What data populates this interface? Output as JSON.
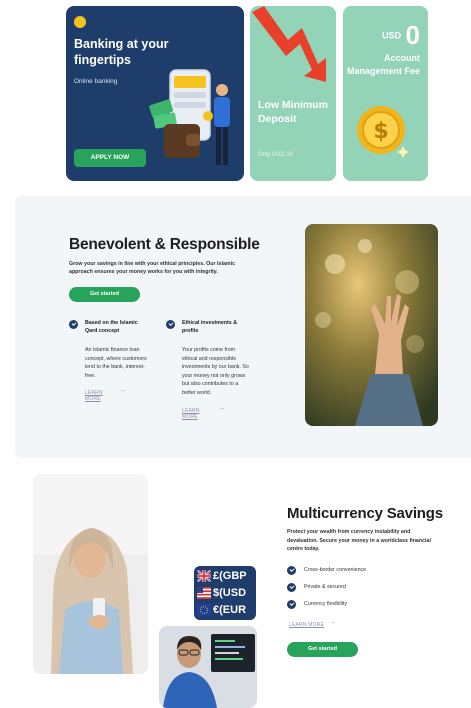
{
  "colors": {
    "navy": "#1f3d6b",
    "mint": "#93d3b8",
    "green": "#27a35b",
    "section_bg": "#f3f6f9"
  },
  "cards": {
    "banking": {
      "title": "Banking at your fingertips",
      "subtitle": "Online banking",
      "button": "APPLY NOW",
      "illustration_icon": "phone-wallet-cash-icon"
    },
    "deposit": {
      "title": "Low Minimum Deposit",
      "subtitle": "Only USD 10",
      "icon": "red-arrow-down-icon"
    },
    "fee": {
      "currency": "USD",
      "value": "0",
      "label": "Account Management Fee",
      "icon": "dollar-coin-icon"
    }
  },
  "benevolent": {
    "title": "Benevolent & Responsible",
    "lead": "Grow your savings in line with your ethical principles. Our Islamic approach ensures your money works for you with integrity.",
    "button": "Get started",
    "features": [
      {
        "title": "Based on the Islamic Qard concept",
        "text": "An Islamic finance loan concept, where customers lend to the bank, interest-free.",
        "link": "LEARN MORE"
      },
      {
        "title": "Ethical investments & profits",
        "text": "Your profits come from ethical and responsible investments by our bank. So your money not only grows but also contributes to a better world.",
        "link": "LEARN MORE"
      }
    ]
  },
  "multicurrency": {
    "title": "Multicurrency Savings",
    "lead": "Protect your wealth from currency instability and devaluation. Secure your money in a worldclass financial centre today.",
    "bullets": [
      "Cross-border convenience",
      "Private & secured",
      "Currency flexibility"
    ],
    "link": "LEARN MORE",
    "button": "Get started",
    "currencies": [
      {
        "symbol": "£",
        "code": "(GBP",
        "flag": "uk-flag-icon"
      },
      {
        "symbol": "$",
        "code": "(USD",
        "flag": "us-flag-icon"
      },
      {
        "symbol": "€",
        "code": "(EUR",
        "flag": "eu-flag-icon"
      }
    ]
  }
}
